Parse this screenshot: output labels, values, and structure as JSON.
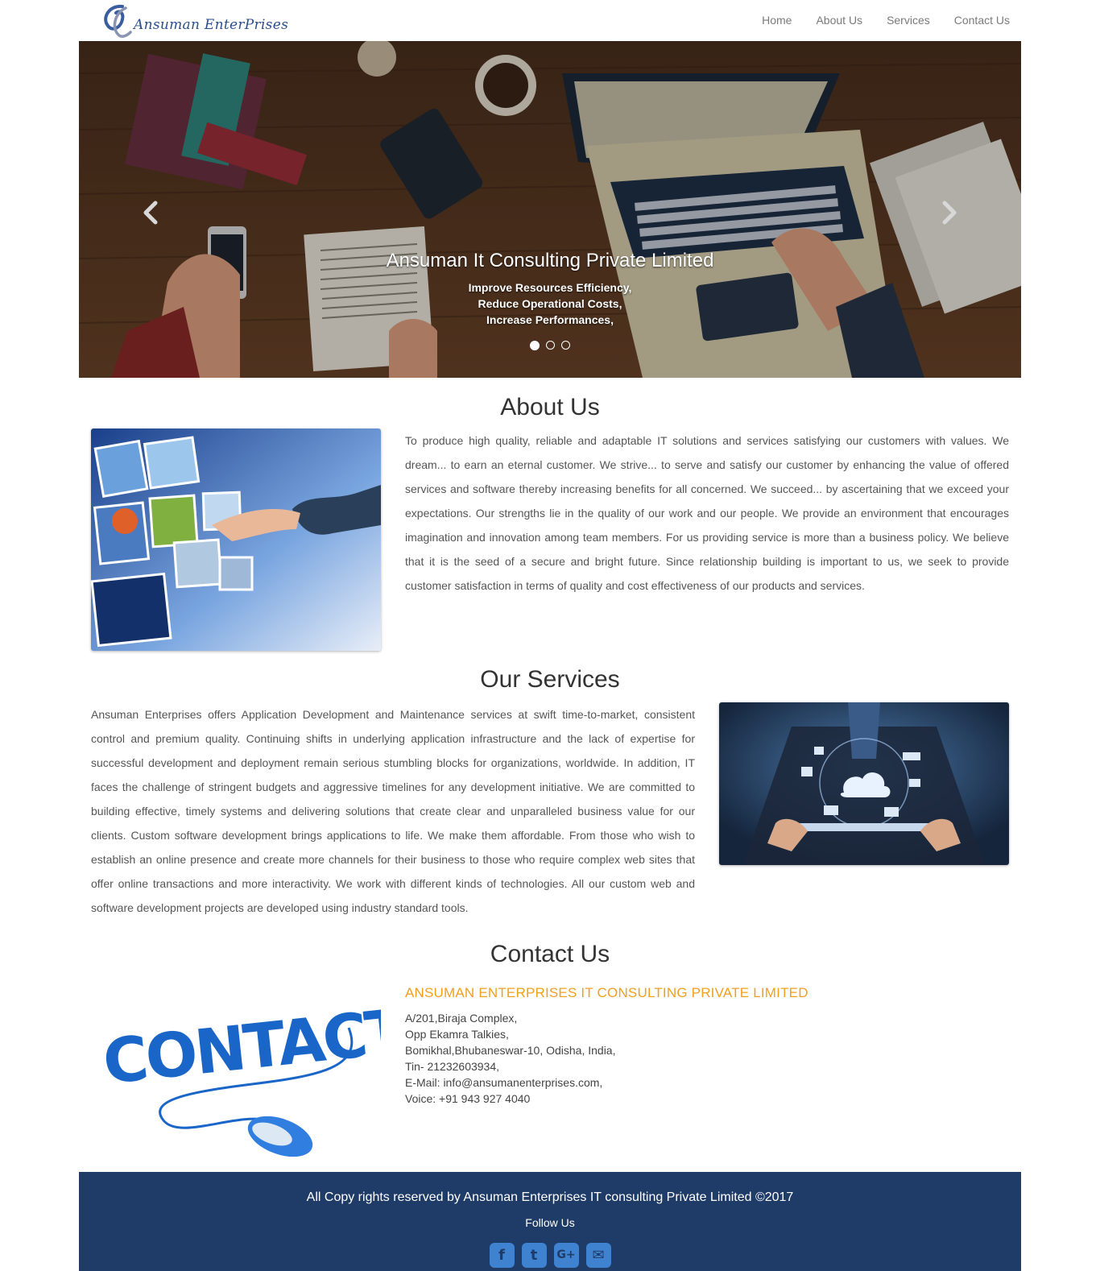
{
  "header": {
    "logo_text": "Ansuman EnterPrises",
    "nav": [
      "Home",
      "About Us",
      "Services",
      "Contact Us"
    ]
  },
  "hero": {
    "title": "Ansuman It Consulting Private Limited",
    "lines": [
      "Improve Resources Efficiency,",
      "Reduce Operational Costs,",
      "Increase Performances,"
    ],
    "slides": 3,
    "active_slide": 1
  },
  "about": {
    "title": "About Us",
    "text": "To produce high quality, reliable and adaptable IT solutions and services satisfying our customers with values. We dream... to earn an eternal customer. We strive... to serve and satisfy our customer by enhancing the value of offered services and software thereby increasing benefits for all concerned. We succeed... by ascertaining that we exceed your expectations. Our strengths lie in the quality of our work and our people. We provide an environment that encourages imagination and innovation among team members. For us providing service is more than a business policy. We believe that it is the seed of a secure and bright future. Since relationship building is important to us, we seek to provide customer satisfaction in terms of quality and cost effectiveness of our products and services."
  },
  "services": {
    "title": "Our Services",
    "text": "Ansuman Enterprises offers Application Development and Maintenance services at swift time-to-market, consistent control and premium quality. Continuing shifts in underlying application infrastructure and the lack of expertise for successful development and deployment remain serious stumbling blocks for organizations, worldwide. In addition, IT faces the challenge of stringent budgets and aggressive timelines for any development initiative. We are committed to building effective, timely systems and delivering solutions that create clear and unparalleled business value for our clients. Custom software development brings applications to life. We make them affordable. From those who wish to establish an online presence and create more channels for their business to those who require complex web sites that offer online transactions and more interactivity. We work with different kinds of technologies. All our custom web and software development projects are developed using industry standard tools."
  },
  "contact": {
    "title": "Contact Us",
    "image_word": "CONTACT",
    "company": "ANSUMAN ENTERPRISES IT CONSULTING PRIVATE LIMITED",
    "address": [
      "A/201,Biraja Complex,",
      "Opp Ekamra Talkies,",
      "Bomikhal,Bhubaneswar-10, Odisha, India,",
      "Tin- 21232603934,",
      "E-Mail: info@ansumanenterprises.com,",
      "Voice: +91 943 927 4040"
    ]
  },
  "footer": {
    "copyright": "All Copy rights reserved by Ansuman Enterprises IT consulting Private Limited ©2017",
    "follow": "Follow Us",
    "socials": [
      {
        "name": "facebook-icon",
        "glyph": "f"
      },
      {
        "name": "twitter-icon",
        "glyph": "t"
      },
      {
        "name": "google-plus-icon",
        "glyph": "G+"
      },
      {
        "name": "email-icon",
        "glyph": "✉"
      }
    ]
  },
  "colors": {
    "footer_bg": "#1f3b68",
    "company_accent": "#f0a020",
    "social_icon": "#3f82d0",
    "logo_blue": "#2b4f8f"
  }
}
